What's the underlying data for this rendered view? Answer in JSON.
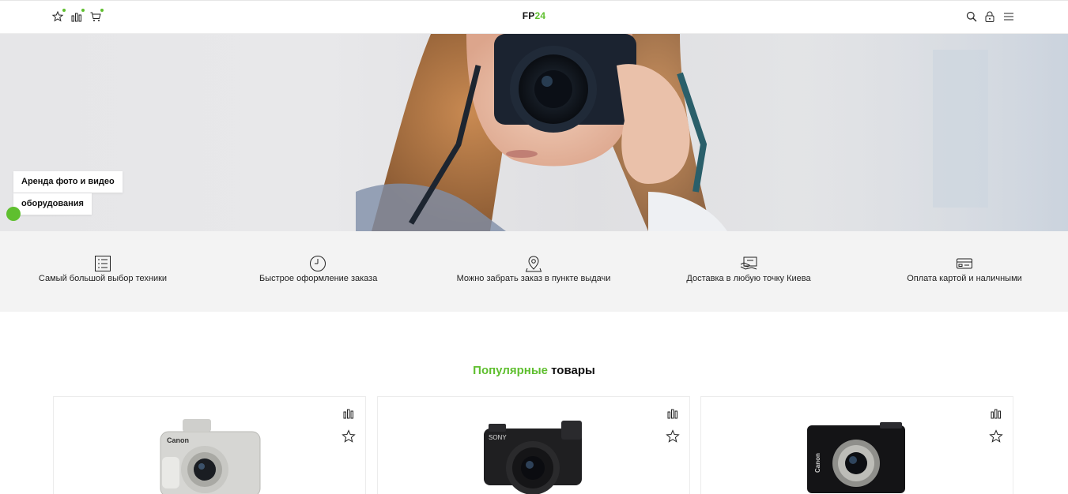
{
  "header": {
    "logo_part1": "FP",
    "logo_part2": "24",
    "left_icons": [
      "star-icon",
      "compare-icon",
      "cart-icon"
    ],
    "right_icons": [
      "search-icon",
      "lock-icon",
      "menu-icon"
    ]
  },
  "hero": {
    "title_line1": "Аренда фото и видео",
    "title_line2": "оборудования"
  },
  "features": [
    {
      "label": "Самый большой выбор техники",
      "icon": "list-icon"
    },
    {
      "label": "Быстрое оформление заказа",
      "icon": "clock-icon"
    },
    {
      "label": "Можно забрать заказ в пункте выдачи",
      "icon": "map-pin-icon"
    },
    {
      "label": "Доставка в любую точку Киева",
      "icon": "delivery-icon"
    },
    {
      "label": "Оплата картой и наличными",
      "icon": "card-icon"
    }
  ],
  "section": {
    "title_accent": "Популярные",
    "title_rest": " товары"
  },
  "products": [
    {
      "brand": "Canon",
      "icon": "camera-icon"
    },
    {
      "brand": "SONY",
      "icon": "camera-icon"
    },
    {
      "brand": "Canon",
      "icon": "camera-icon"
    }
  ],
  "colors": {
    "accent": "#5fbf2f",
    "features_bg": "#f3f3f3",
    "text": "#111111"
  }
}
